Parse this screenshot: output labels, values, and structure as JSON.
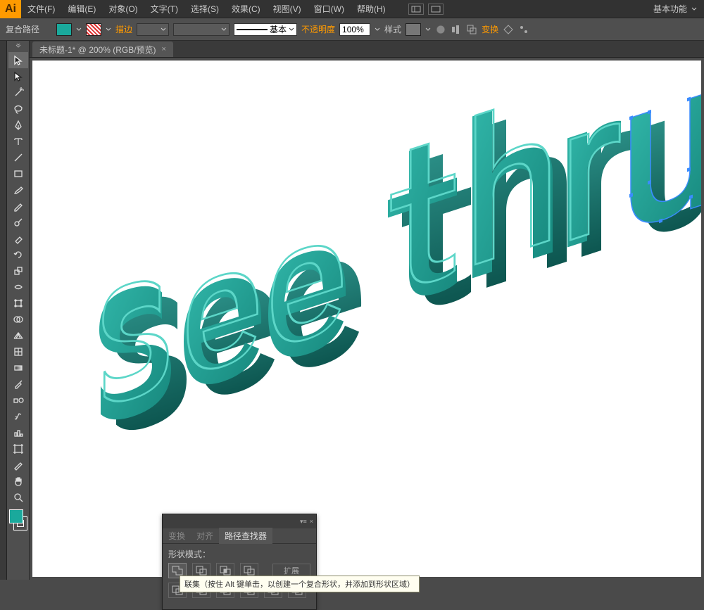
{
  "app": {
    "logo": "Ai"
  },
  "menu": {
    "file": "文件(F)",
    "edit": "编辑(E)",
    "object": "对象(O)",
    "type": "文字(T)",
    "select": "选择(S)",
    "effect": "效果(C)",
    "view": "视图(V)",
    "window": "窗口(W)",
    "help": "帮助(H)"
  },
  "workspace_label": "基本功能",
  "control": {
    "selection_label": "复合路径",
    "fill_color": "#1aa99c",
    "stroke_label": "描边",
    "stroke_style_label": "基本",
    "opacity_label": "不透明度",
    "opacity_value": "100%",
    "style_label": "样式",
    "transform_label": "变换"
  },
  "tab": {
    "title": "未标题-1* @ 200% (RGB/预览)"
  },
  "artwork": {
    "word1": "see",
    "word2": "thru",
    "accent": "#1aa99c"
  },
  "panel": {
    "tabs": {
      "transform": "变换",
      "align": "对齐",
      "pathfinder": "路径查找器"
    },
    "shape_modes_label": "形状模式：",
    "expand_label": "扩展"
  },
  "tooltip": "联集（按住 Alt 键单击，以创建一个复合形状，并添加到形状区域）"
}
